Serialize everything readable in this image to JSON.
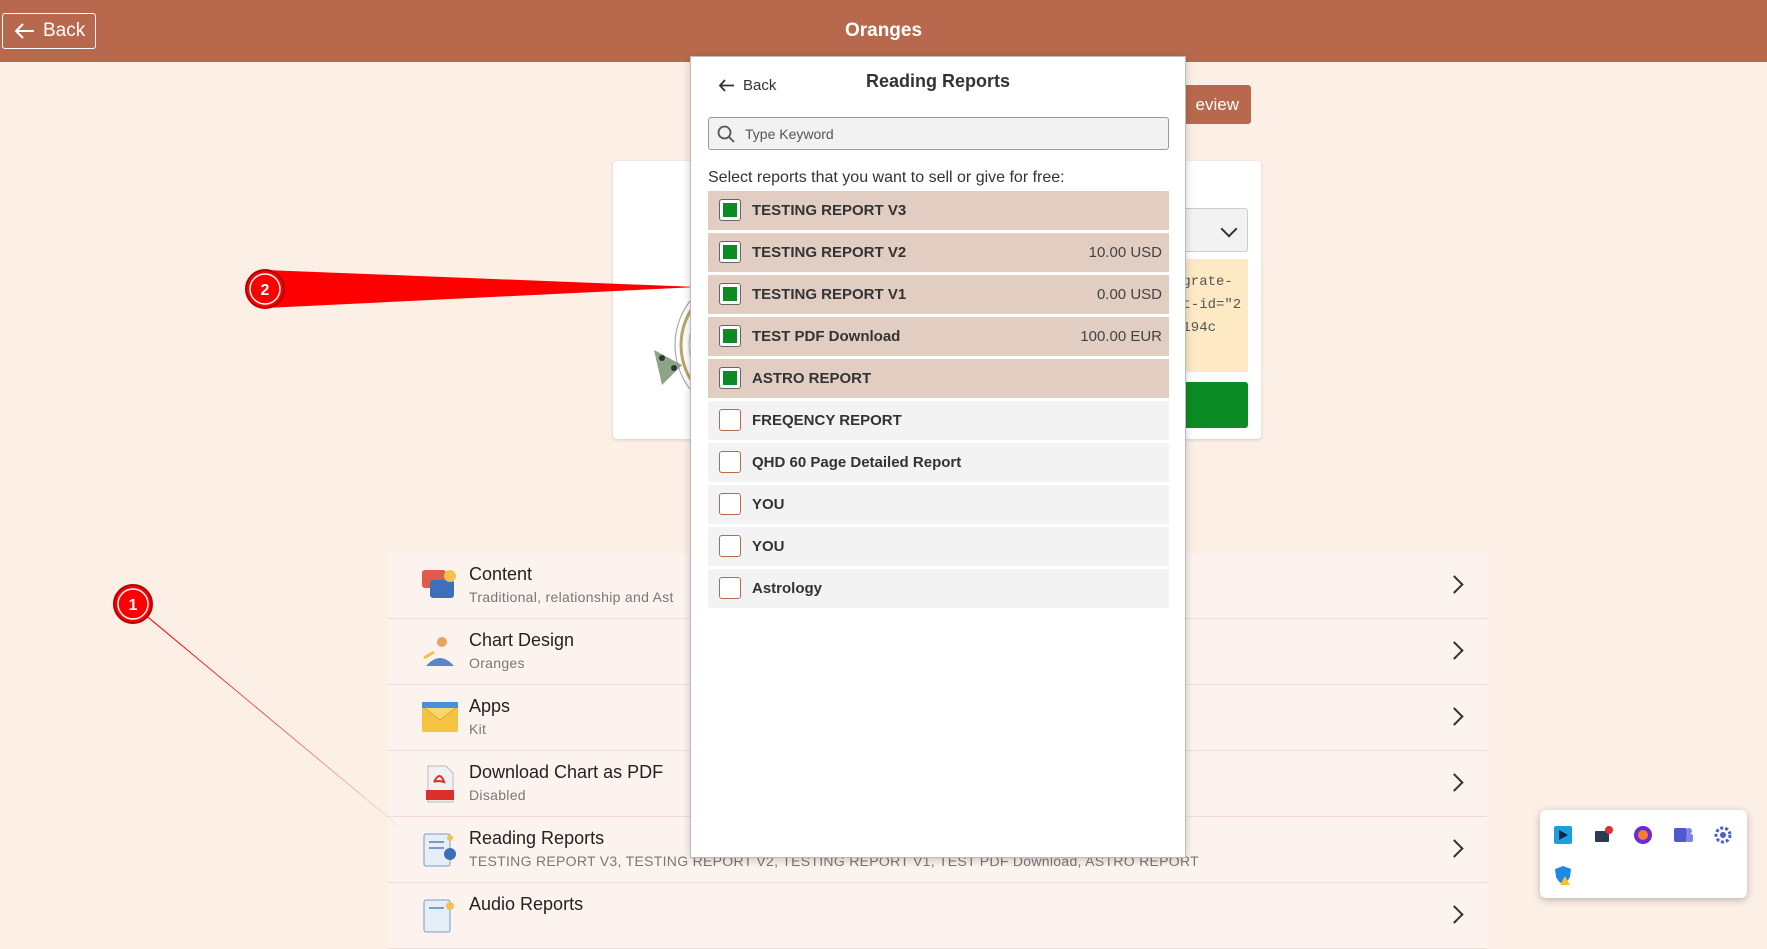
{
  "header": {
    "back_label": "Back",
    "title": "Oranges"
  },
  "background": {
    "preview_button_label": "eview",
    "code_lines": [
      "egrate-",
      "rt-id=\"2",
      "9194c"
    ]
  },
  "settings_list": [
    {
      "title": "Content",
      "subtitle": "Traditional, relationship and Ast",
      "icon": "content-icon"
    },
    {
      "title": "Chart Design",
      "subtitle": "Oranges",
      "icon": "chart-design-icon"
    },
    {
      "title": "Apps",
      "subtitle": "Kit",
      "icon": "apps-icon"
    },
    {
      "title": "Download Chart as PDF",
      "subtitle": "Disabled",
      "icon": "pdf-icon"
    },
    {
      "title": "Reading Reports",
      "subtitle": "TESTING REPORT V3, TESTING REPORT V2, TESTING REPORT V1, TEST PDF Download, ASTRO REPORT",
      "icon": "reading-reports-icon"
    },
    {
      "title": "Audio Reports",
      "subtitle": "",
      "icon": "audio-reports-icon"
    }
  ],
  "modal": {
    "back_label": "Back",
    "title": "Reading Reports",
    "search_placeholder": "Type Keyword",
    "instruction": "Select reports that you want to sell or give for free:",
    "reports": [
      {
        "name": "TESTING REPORT V3",
        "price": "",
        "selected": true
      },
      {
        "name": "TESTING REPORT V2",
        "price": "10.00 USD",
        "selected": true
      },
      {
        "name": "TESTING REPORT V1",
        "price": "0.00 USD",
        "selected": true
      },
      {
        "name": "TEST PDF Download",
        "price": "100.00 EUR",
        "selected": true
      },
      {
        "name": "ASTRO REPORT",
        "price": "",
        "selected": true
      },
      {
        "name": "FREQENCY REPORT",
        "price": "",
        "selected": false
      },
      {
        "name": "QHD 60 Page Detailed Report",
        "price": "",
        "selected": false
      },
      {
        "name": "YOU",
        "price": "",
        "selected": false
      },
      {
        "name": "YOU",
        "price": "",
        "selected": false
      },
      {
        "name": "Astrology",
        "price": "",
        "selected": false
      }
    ]
  },
  "annotations": [
    {
      "label": "1"
    },
    {
      "label": "2"
    }
  ],
  "tray": {
    "icons": [
      "app-icon-1",
      "app-icon-2",
      "app-icon-3",
      "teams-icon",
      "settings-icon",
      "shield-warning-icon"
    ]
  },
  "colors": {
    "brand": "#b8694d",
    "background": "#fcefe6",
    "check_green": "#0c8a23",
    "selected_row": "#e1cdc1",
    "annotation_red": "#ff0000"
  }
}
